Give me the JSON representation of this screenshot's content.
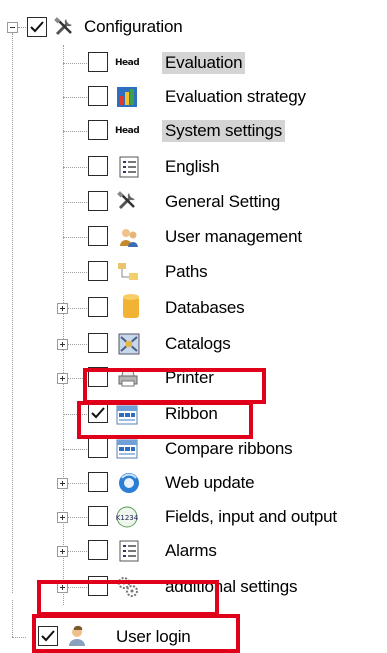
{
  "tree": {
    "root": {
      "label": "Configuration",
      "checked": true,
      "icon": "tools-icon"
    },
    "items": [
      {
        "label": "Evaluation",
        "icon": "head-icon",
        "checked": false,
        "expandable": false,
        "selected": true
      },
      {
        "label": "Evaluation strategy",
        "icon": "strategy-icon",
        "checked": false,
        "expandable": false,
        "selected": false
      },
      {
        "label": "System settings",
        "icon": "head-icon",
        "checked": false,
        "expandable": false,
        "selected": true
      },
      {
        "label": "English",
        "icon": "list-icon",
        "checked": false,
        "expandable": false,
        "selected": false
      },
      {
        "label": "General Setting",
        "icon": "tools-icon",
        "checked": false,
        "expandable": false,
        "selected": false
      },
      {
        "label": "User management",
        "icon": "users-icon",
        "checked": false,
        "expandable": false,
        "selected": false
      },
      {
        "label": "Paths",
        "icon": "paths-icon",
        "checked": false,
        "expandable": false,
        "selected": false
      },
      {
        "label": "Databases",
        "icon": "database-icon",
        "checked": false,
        "expandable": true,
        "selected": false
      },
      {
        "label": "Catalogs",
        "icon": "catalog-icon",
        "checked": false,
        "expandable": true,
        "selected": false
      },
      {
        "label": "Printer",
        "icon": "printer-icon",
        "checked": false,
        "expandable": true,
        "selected": false
      },
      {
        "label": "Ribbon",
        "icon": "ribbon-icon",
        "checked": true,
        "expandable": false,
        "selected": false
      },
      {
        "label": "Compare ribbons",
        "icon": "ribbon-icon",
        "checked": false,
        "expandable": false,
        "selected": false
      },
      {
        "label": "Web update",
        "icon": "globe-icon",
        "checked": false,
        "expandable": true,
        "selected": false
      },
      {
        "label": "Fields, input and output",
        "icon": "fields-icon",
        "checked": false,
        "expandable": true,
        "selected": false
      },
      {
        "label": "Alarms",
        "icon": "list-icon",
        "checked": false,
        "expandable": true,
        "selected": false
      },
      {
        "label": "additional settings",
        "icon": "settings-icon",
        "checked": false,
        "expandable": true,
        "selected": false
      }
    ],
    "bottom": {
      "label": "User login",
      "checked": true,
      "icon": "user-icon"
    },
    "head_icon_text": "Head"
  },
  "colors": {
    "highlight_red": "#e1001a",
    "selection_gray": "#d4d4d4"
  }
}
